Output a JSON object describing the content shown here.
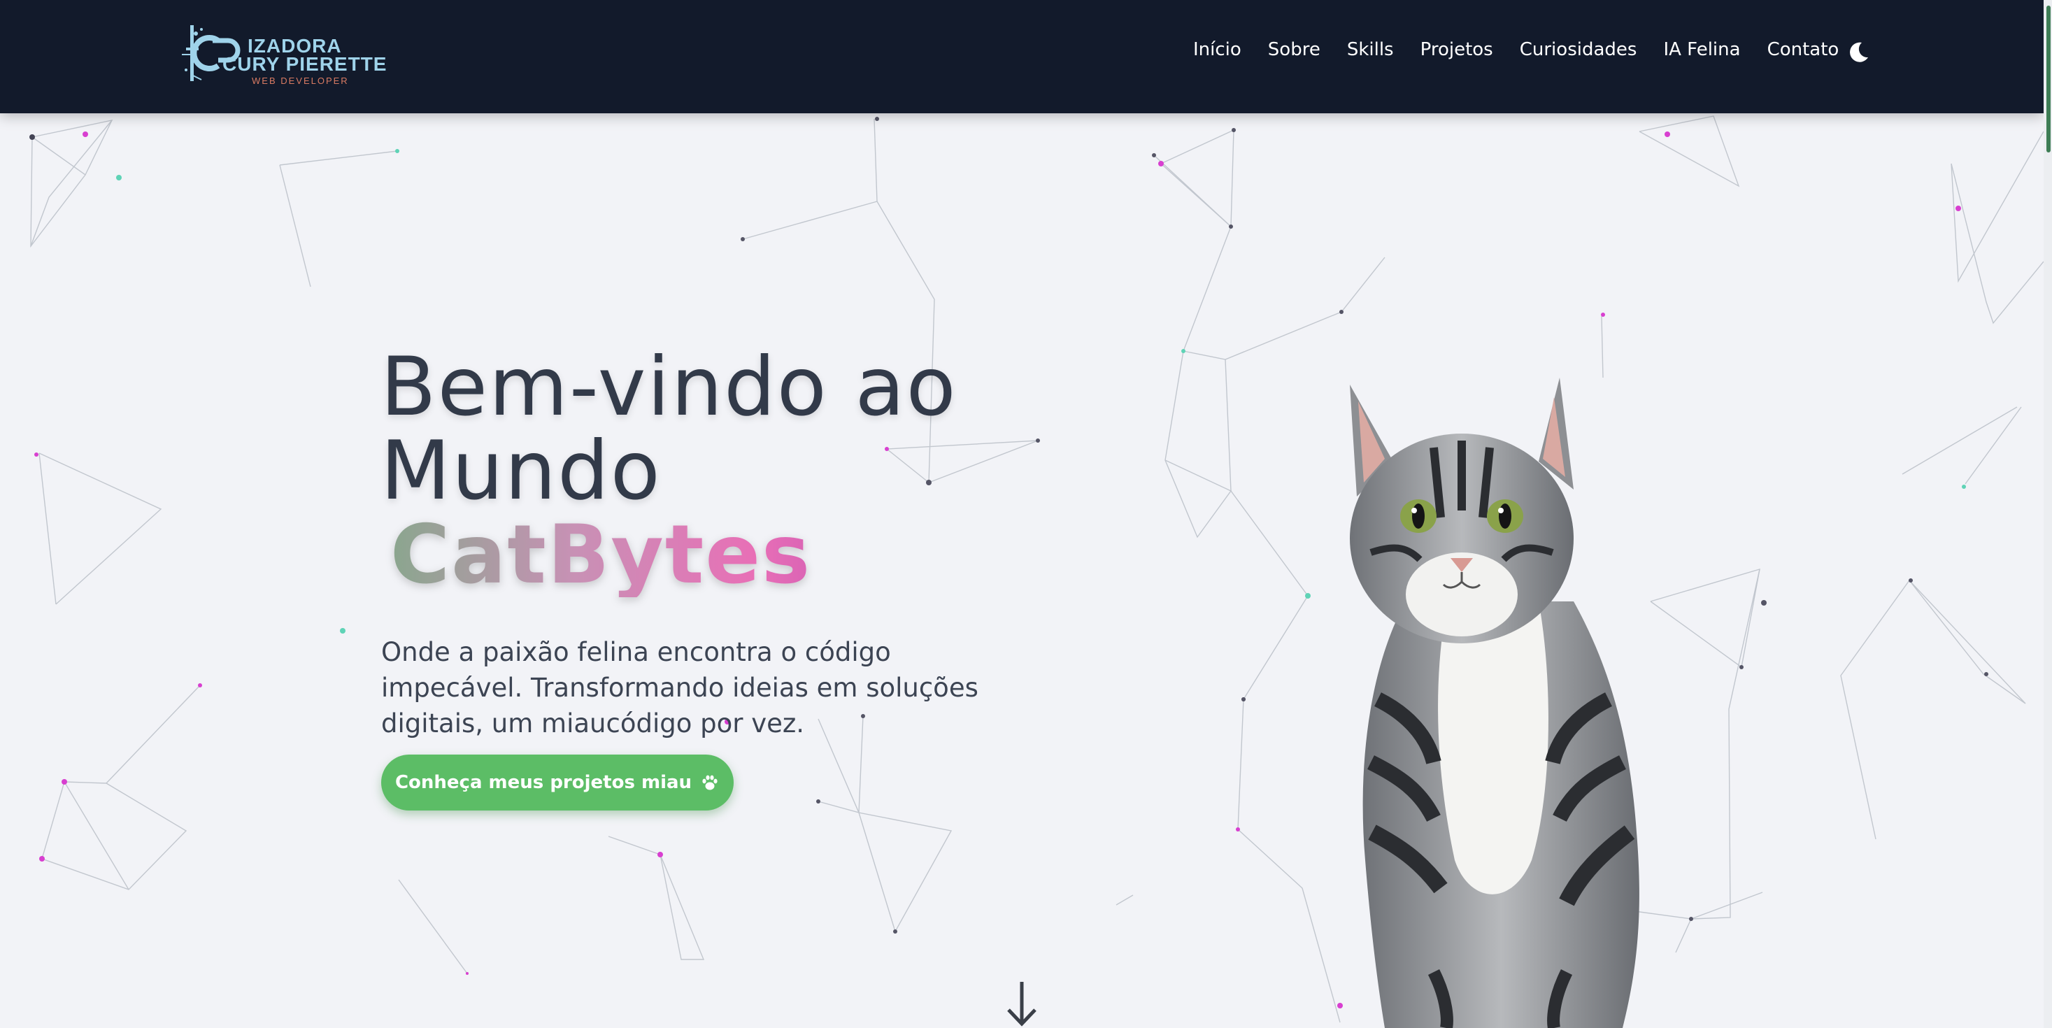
{
  "brand": {
    "name_line1": "IZADORA",
    "name_line2": "CURY PIERETTE",
    "tagline": "WEB DEVELOPER",
    "colors": {
      "name": "#9fd3ea",
      "tagline": "#d87a62"
    }
  },
  "nav": {
    "items": [
      {
        "label": "Início"
      },
      {
        "label": "Sobre"
      },
      {
        "label": "Skills"
      },
      {
        "label": "Projetos"
      },
      {
        "label": "Curiosidades"
      },
      {
        "label": "IA Felina"
      },
      {
        "label": "Contato"
      }
    ],
    "theme_toggle_icon": "moon-icon"
  },
  "hero": {
    "title_line1": "Bem-vindo ao",
    "title_line2": "Mundo",
    "title_highlight": "CatBytes",
    "subtitle": "Onde a paixão felina encontra o código impecável. Transformando ideias em soluções digitais, um miaucódigo por vez.",
    "cta_label": "Conheça meus projetos miau",
    "cta_icon": "paw-icon",
    "scroll_icon": "arrow-down-icon",
    "image": "tabby-cat"
  },
  "colors": {
    "navbar_bg": "#121a2b",
    "page_bg": "#f2f3f7",
    "title": "#323a49",
    "cta_bg": "#5cbd66",
    "gradient": [
      "#8aa68e",
      "#e86fb6",
      "#a63aa6"
    ]
  }
}
